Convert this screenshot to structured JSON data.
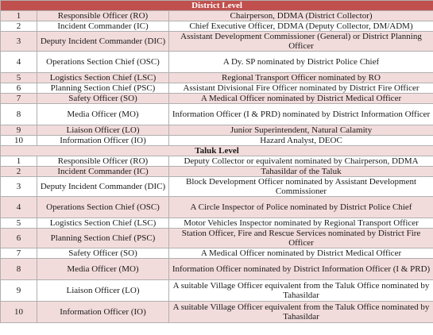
{
  "district": {
    "heading": "District Level",
    "rows": [
      {
        "no": "1",
        "role": "Responsible Officer (RO)",
        "assignee": "Chairperson, DDMA (District Collector)"
      },
      {
        "no": "2",
        "role": "Incident Commander (IC)",
        "assignee": "Chief Executive Officer, DDMA (Deputy Collector, DM/ADM)"
      },
      {
        "no": "3",
        "role": "Deputy Incident Commander (DIC)",
        "assignee": "Assistant Development Commissioner (General) or District Planning Officer"
      },
      {
        "no": "4",
        "role": "Operations Section Chief (OSC)",
        "assignee": "A Dy. SP nominated by District Police Chief"
      },
      {
        "no": "5",
        "role": "Logistics Section Chief (LSC)",
        "assignee": "Regional Transport Officer nominated by RO"
      },
      {
        "no": "6",
        "role": "Planning Section Chief (PSC)",
        "assignee": "Assistant Divisional Fire Officer nominated by District Fire Officer"
      },
      {
        "no": "7",
        "role": "Safety Officer (SO)",
        "assignee": "A Medical Officer nominated by District Medical Officer"
      },
      {
        "no": "8",
        "role": "Media Officer (MO)",
        "assignee": "Information Officer (I & PRD) nominated by District Information Officer"
      },
      {
        "no": "9",
        "role": "Liaison Officer (LO)",
        "assignee": "Junior Superintendent, Natural Calamity"
      },
      {
        "no": "10",
        "role": "Information Officer (IO)",
        "assignee": "Hazard Analyst, DEOC"
      }
    ]
  },
  "taluk": {
    "heading": "Taluk Level",
    "rows": [
      {
        "no": "1",
        "role": "Responsible Officer (RO)",
        "assignee": "Deputy Collector or equivalent nominated by Chairperson, DDMA"
      },
      {
        "no": "2",
        "role": "Incident Commander (IC)",
        "assignee": "Tahasildar of the Taluk"
      },
      {
        "no": "3",
        "role": "Deputy Incident Commander (DIC)",
        "assignee": "Block Development Officer nominated by Assistant Development Commissioner"
      },
      {
        "no": "4",
        "role": "Operations Section Chief (OSC)",
        "assignee": "A Circle Inspector of Police nominated by District Police Chief"
      },
      {
        "no": "5",
        "role": "Logistics Section Chief (LSC)",
        "assignee": "Motor Vehicles Inspector nominated by Regional Transport Officer"
      },
      {
        "no": "6",
        "role": "Planning Section Chief (PSC)",
        "assignee": "Station Officer, Fire and Rescue Services nominated by District Fire Officer"
      },
      {
        "no": "7",
        "role": "Safety Officer (SO)",
        "assignee": "A Medical Officer nominated by District Medical Officer"
      },
      {
        "no": "8",
        "role": "Media Officer (MO)",
        "assignee": "Information Officer nominated by District Information Officer (I & PRD)"
      },
      {
        "no": "9",
        "role": "Liaison Officer (LO)",
        "assignee": "A suitable Village Officer equivalent from the Taluk Office nominated by Tahasildar"
      },
      {
        "no": "10",
        "role": "Information Officer (IO)",
        "assignee": "A suitable Village Officer equivalent from the Taluk Office nominated by Tahasildar"
      }
    ]
  }
}
